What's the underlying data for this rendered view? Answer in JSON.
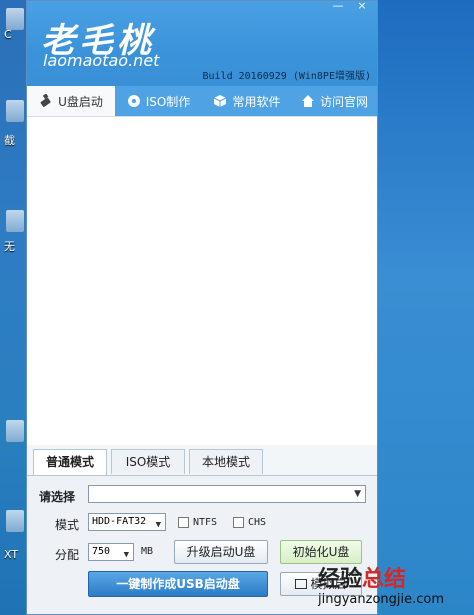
{
  "desktop": {
    "labels": [
      "C",
      "截",
      "无",
      "XT"
    ]
  },
  "window": {
    "logo_cn": "老毛桃",
    "logo_en": "laomaotao.net",
    "build": "Build 20160929 (Win8PE增强版)",
    "minimize": "—",
    "close": "×"
  },
  "tabs": [
    {
      "label": "U盘启动",
      "icon": "usb-icon"
    },
    {
      "label": "ISO制作",
      "icon": "disc-icon"
    },
    {
      "label": "常用软件",
      "icon": "cube-icon"
    },
    {
      "label": "访问官网",
      "icon": "home-icon"
    }
  ],
  "mode_tabs": [
    "普通模式",
    "ISO模式",
    "本地模式"
  ],
  "panel": {
    "select_label": "请选择",
    "mode_label": "模式",
    "mode_value": "HDD-FAT32",
    "ntfs": "NTFS",
    "chs": "CHS",
    "partition_label": "分配",
    "partition_value": "750",
    "mb": "MB",
    "upgrade": "升级启动U盘",
    "init": "初始化U盘",
    "make": "一键制作成USB启动盘",
    "simulate": "模拟启"
  },
  "watermark": {
    "cn_prefix": "经验",
    "cn_suffix": "总结",
    "url": "jingyanzongjie.com"
  },
  "colors": {
    "title_blue": "#3a93da",
    "tab_blue": "#4fa3e5",
    "make_button": "#2c7cc6"
  }
}
